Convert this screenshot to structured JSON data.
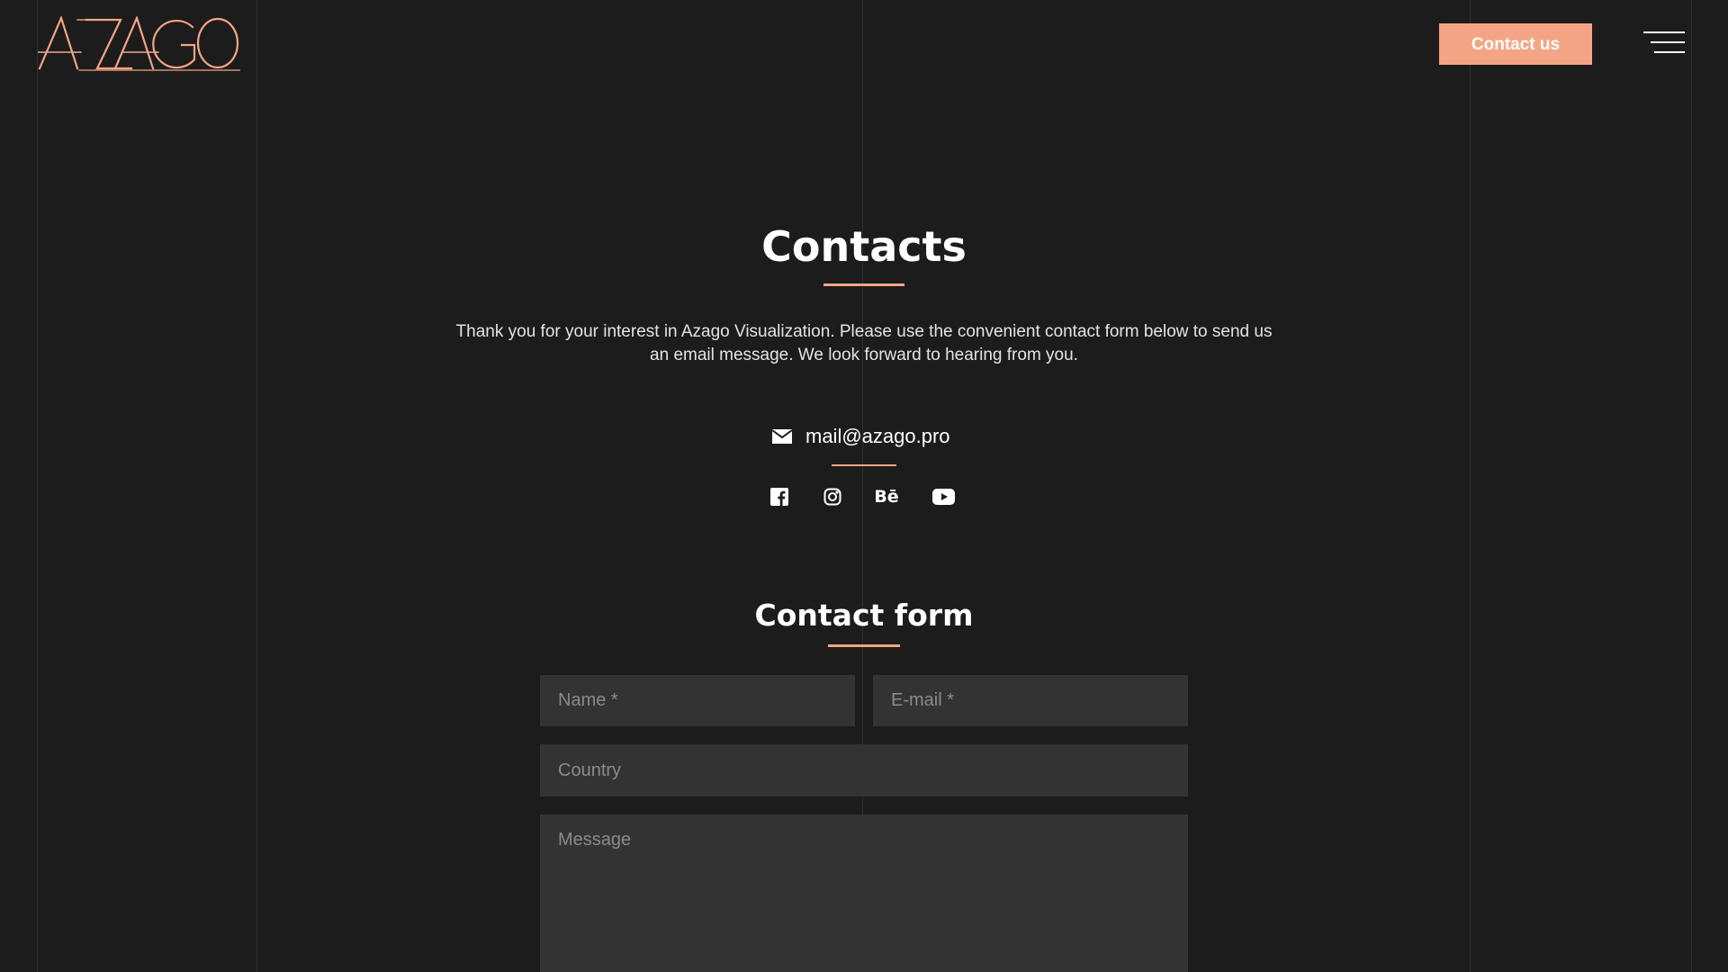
{
  "header": {
    "logo_text": "AZAGO",
    "contact_button": "Contact us",
    "menu_icon": "hamburger-menu-icon"
  },
  "colors": {
    "background": "#1c1c1c",
    "accent": "#f4a585",
    "input_bg": "#333333"
  },
  "main": {
    "title": "Contacts",
    "intro": "Thank you for your interest in Azago Visualization. Please use the convenient contact form below to send us an email message. We look forward to hearing from you.",
    "email": "mail@azago.pro",
    "email_icon": "envelope-icon",
    "socials": [
      {
        "name": "facebook",
        "icon": "facebook-icon"
      },
      {
        "name": "instagram",
        "icon": "instagram-icon"
      },
      {
        "name": "behance",
        "icon": "behance-icon",
        "glyph": "Bē"
      },
      {
        "name": "youtube",
        "icon": "youtube-icon"
      }
    ]
  },
  "form": {
    "title": "Contact form",
    "name_placeholder": "Name *",
    "email_placeholder": "E-mail *",
    "country_placeholder": "Country",
    "message_placeholder": "Message"
  }
}
